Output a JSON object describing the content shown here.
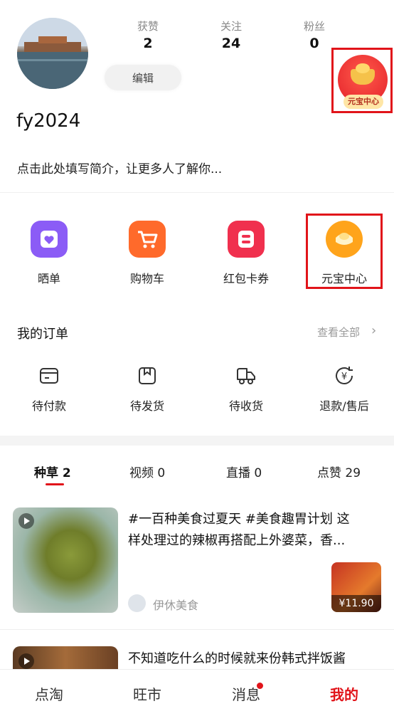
{
  "profile": {
    "username": "fy2024",
    "bio": "点击此处填写简介，让更多人了解你...",
    "edit_label": "编辑",
    "stats": [
      {
        "label": "获赞",
        "value": "2"
      },
      {
        "label": "关注",
        "value": "24"
      },
      {
        "label": "粉丝",
        "value": "0"
      }
    ],
    "yuanbao_badge": "元宝中心"
  },
  "quick_actions": [
    {
      "label": "晒单",
      "icon": "heart-card-icon",
      "color": "#8b5cf6"
    },
    {
      "label": "购物车",
      "icon": "cart-icon",
      "color": "#ff6a2b"
    },
    {
      "label": "红包卡券",
      "icon": "coupon-icon",
      "color": "#f0304e"
    },
    {
      "label": "元宝中心",
      "icon": "gold-ingot-icon",
      "color": "#ffa41b"
    }
  ],
  "orders": {
    "title": "我的订单",
    "view_all": "查看全部",
    "items": [
      {
        "label": "待付款",
        "icon": "wallet-icon"
      },
      {
        "label": "待发货",
        "icon": "package-icon"
      },
      {
        "label": "待收货",
        "icon": "truck-icon"
      },
      {
        "label": "退款/售后",
        "icon": "refund-icon"
      }
    ]
  },
  "content_tabs": [
    {
      "label": "种草 2"
    },
    {
      "label": "视频 0"
    },
    {
      "label": "直播 0"
    },
    {
      "label": "点赞 29"
    }
  ],
  "posts": [
    {
      "line1": "#一百种美食过夏天 #美食趣胃计划 这",
      "line2": "样处理过的辣椒再搭配上外婆菜，香...",
      "author": "伊休美食",
      "price": "¥11.90"
    },
    {
      "line1": "不知道吃什么的时候就来份韩式拌饭酱"
    }
  ],
  "bottom_nav": [
    {
      "label": "点淘"
    },
    {
      "label": "旺市"
    },
    {
      "label": "消息"
    },
    {
      "label": "我的"
    }
  ],
  "colors": {
    "accent": "#e1141a"
  }
}
